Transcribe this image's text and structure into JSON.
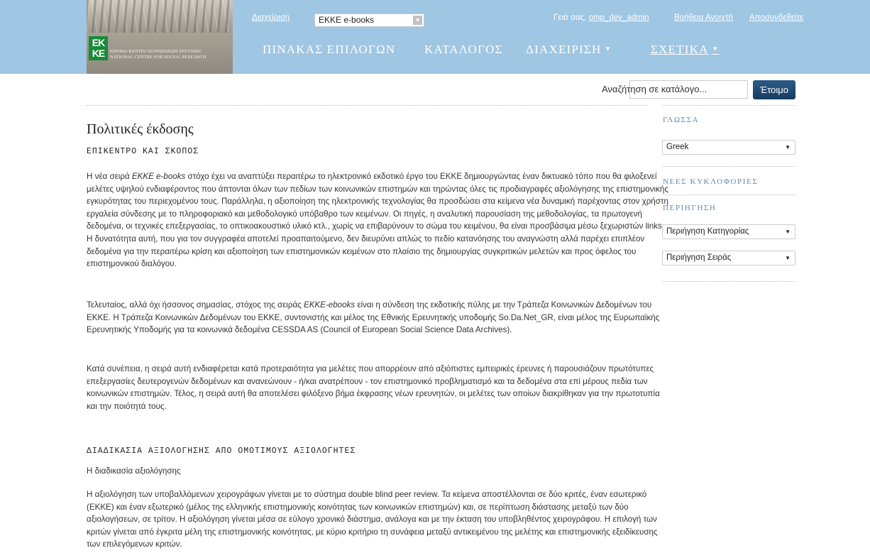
{
  "header": {
    "logo": {
      "mark_line1": "ΕΚ",
      "mark_line2": "ΚΕ",
      "name_el": "ΕΘΝΙΚΟ ΚΕΝΤΡΟ ΚΟΙΝΩΝΙΚΩΝ ΕΡΕΥΝΩΝ",
      "name_en": "NATIONAL CENTRE FOR SOCIAL RESEARCH"
    },
    "admin_link": "Διαχείριση",
    "context_select": {
      "value": "EKKE e-books"
    },
    "greeting_prefix": "Γειά σας,",
    "username": "omp_dev_admin",
    "help_link": "Βοήθεια Ανοιχτή",
    "logout_link": "Αποσυνδεθείτε",
    "nav": [
      {
        "label": "ΠΙΝΑΚΑΣ ΕΠΙΛΟΓΩΝ"
      },
      {
        "label": "ΚΑΤΑΛΟΓΟΣ"
      },
      {
        "label": "ΔΙΑΧΕΙΡΙΣΗ"
      },
      {
        "label": "ΣΧΕΤΙΚΑ"
      }
    ],
    "background_color": "#9fc6e2"
  },
  "search": {
    "placeholder": "Αναζήτηση σε κατάλογο...",
    "button_label": "Έτοιμο"
  },
  "main": {
    "title": "Πολιτικές έκδοσης",
    "section1_heading": "ΕΠΙΚΕΝΤΡΟ ΚΑΙ ΣΚΟΠΟΣ",
    "p1": {
      "a": "Η νέα σειρά ",
      "em": "EKKE e-books",
      "b": " στόχο έχει να αναπτύξει περαιτέρω το ηλεκτρονικό εκδοτικό έργο του ΕΚΚΕ δημιουργώντας έναν δικτυακό τόπο που θα φιλοξενεί μελέτες υψηλού ενδιαφέροντος που άπτονται όλων των πεδίων των κοινωνικών επιστημών και τηρώντας όλες τις προδιαγραφές αξιολόγησης της επιστημονικής εγκυρότητας του περιεχομένου τους. Παράλληλα, η αξιοποίηση της ηλεκτρονικής τεχνολογίας θα προσδώσει στα κείμενα νέα δυναμική παρέχοντας στον χρήστη εργαλεία σύνδεσης με το πληροφοριακό και μεθοδολογικό υπόβαθρο των κειμένων. Οι πηγές, η αναλυτική παρουσίαση της μεθοδολογίας, τα πρωτογενή δεδομένα, οι τεχνικές επεξεργασίας, το οπτικοακουστικό υλικό κτλ., χωρίς να επιβαρύνουν το σώμα του κειμένου, θα είναι προσβάσιμα μέσω ξεχωριστών links. Η δυνατότητα αυτή, που για τον συγγραφέα αποτελεί προαπαιτούμενο, δεν διευρύνει απλώς το πεδίο κατανόησης του αναγνώστη αλλά παρέχει επιπλέον δεδομένα για την περαιτέρω κρίση και αξιοποίηση των επιστημονικών κειμένων στο πλαίσιο της δημιουργίας συγκριτικών μελετών και προς όφελος του επιστημονικού διαλόγου."
    },
    "p2": {
      "a": "Τελευταίος, αλλά όχι ήσσονος σημασίας, στόχος της σειράς ",
      "em": "EKKE-ebooks",
      "b": " είναι η σύνδεση της εκδοτικής πύλης με την Τράπεζα Κοινωνικών Δεδομένων του ΕΚΚΕ. Η Τράπεζα Κοινωνικών Δεδομένων του ΕΚΚΕ, συντονιστής και μέλος της Εθνικής Ερευνητικής υποδομής So.Da.Net_GR, είναι μέλος της Ευρωπαϊκής Ερευνητικής Υποδομής για τα κοινωνικά δεδομένα CESSDA AS (Council of European Social Science Data Archives)."
    },
    "p3": "Κατά συνέπεια, η σειρά αυτή ενδιαφέρεται κατά προτεραιότητα για μελέτες που απορρέουν από αξιόπιστες εμπειρικές έρευνες ή παρουσιάζουν πρωτότυπες επεξεργασίες δευτερογενών δεδομένων και ανανεώνουν - ή/και ανατρέπουν - τον επιστημονικό προβληματισμό και τα δεδομένα στα επί μέρους πεδία των κοινωνικών επιστημών. Τέλος, η σειρά αυτή θα αποτελέσει φιλόξενο βήμα έκφρασης νέων ερευνητών, οι μελέτες των οποίων διακρίθηκαν για την πρωτοτυπία και την ποιότητά τους.",
    "section2_heading": "ΔΙΑΔΙΚΑΣΙΑ ΑΞΙΟΛΟΓΗΣΗΣ ΑΠΟ ΟΜΟΤΙΜΟΥΣ ΑΞΙΟΛΟΓΗΤΕΣ",
    "section2_sublabel": "Η διαδικασία αξιολόγησης",
    "p4": "Η αξιολόγηση των υποβαλλόμενων χειρογράφων γίνεται με το σύστημα double blind peer review. Τα κείμενα αποστέλλονται σε δύο κριτές, έναν εσωτερικό (ΕΚΚΕ) και έναν εξωτερικό (μέλος της ελληνικής επιστημονικής κοινότητας των κοινωνικών επιστημών) και, σε περίπτωση διάστασης μεταξύ των δύο αξιολογήσεων, σε τρίτον. Η αξιολόγηση γίνεται μέσα σε εύλογο χρονικό διάστημα, ανάλογα και με την έκταση του υποβληθέντος χειρογράφου. Η επιλογή των κριτών γίνεται από έγκριτα μέλη της επιστημονικής κοινότητας, με κύριο κριτήριο τη συνάφεια μεταξύ αντικειμένου της μελέτης και επιστημονικής εξειδίκευσης των επιλεγόμενων κριτών."
  },
  "sidebar": {
    "language_heading": "ΓΛΩΣΣΑ",
    "language_value": "Greek",
    "new_releases_heading": "ΝΕΕΣ ΚΥΚΛΟΦΟΡΙΕΣ",
    "browse_heading": "ΠΕΡΙΗΓΗΣΗ",
    "browse_category_value": "Περιήγηση Κατηγορίας",
    "browse_series_value": "Περιήγηση Σειράς",
    "heading_color": "#5f8ab0"
  }
}
